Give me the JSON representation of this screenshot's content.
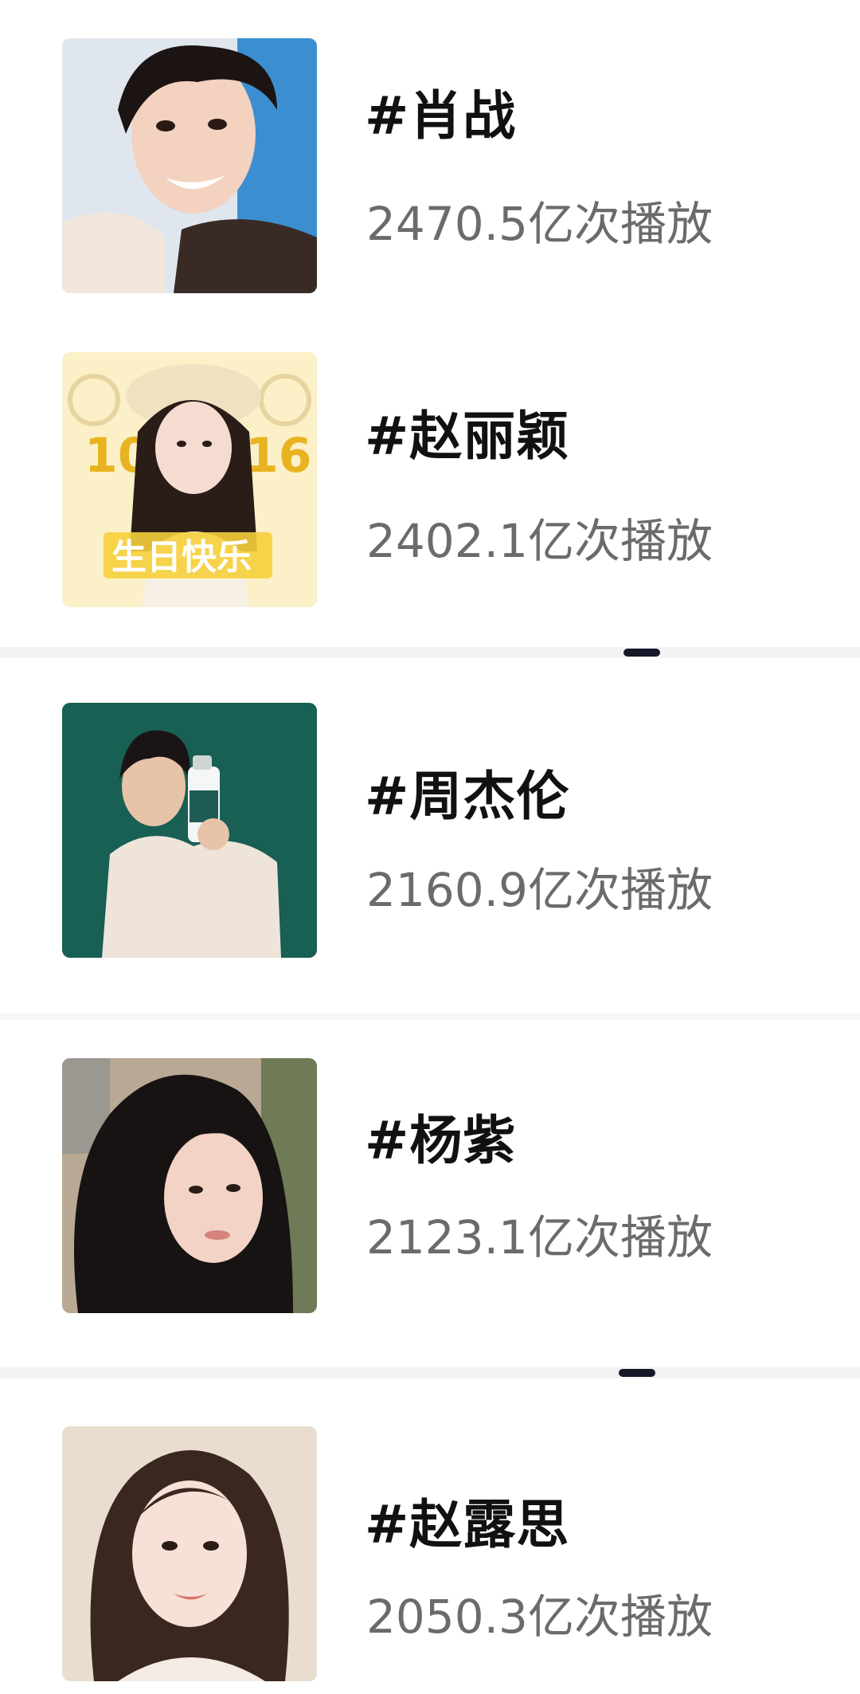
{
  "items": [
    {
      "tag": "#肖战",
      "plays": "2470.5亿次播放",
      "photo": "portrait-photo"
    },
    {
      "tag": "#赵丽颖",
      "plays": "2402.1亿次播放",
      "photo": "birthday-poster-photo",
      "poster_text": "生日快乐",
      "poster_numbers": [
        "10",
        "16"
      ]
    },
    {
      "tag": "#周杰伦",
      "plays": "2160.9亿次播放",
      "photo": "portrait-photo"
    },
    {
      "tag": "#杨紫",
      "plays": "2123.1亿次播放",
      "photo": "portrait-photo"
    },
    {
      "tag": "#赵露思",
      "plays": "2050.3亿次播放",
      "photo": "portrait-photo"
    }
  ],
  "colors": {
    "title": "#111111",
    "subtitle": "#6b6b6b",
    "separator": "#f3f3f5",
    "handle": "#17172a"
  }
}
